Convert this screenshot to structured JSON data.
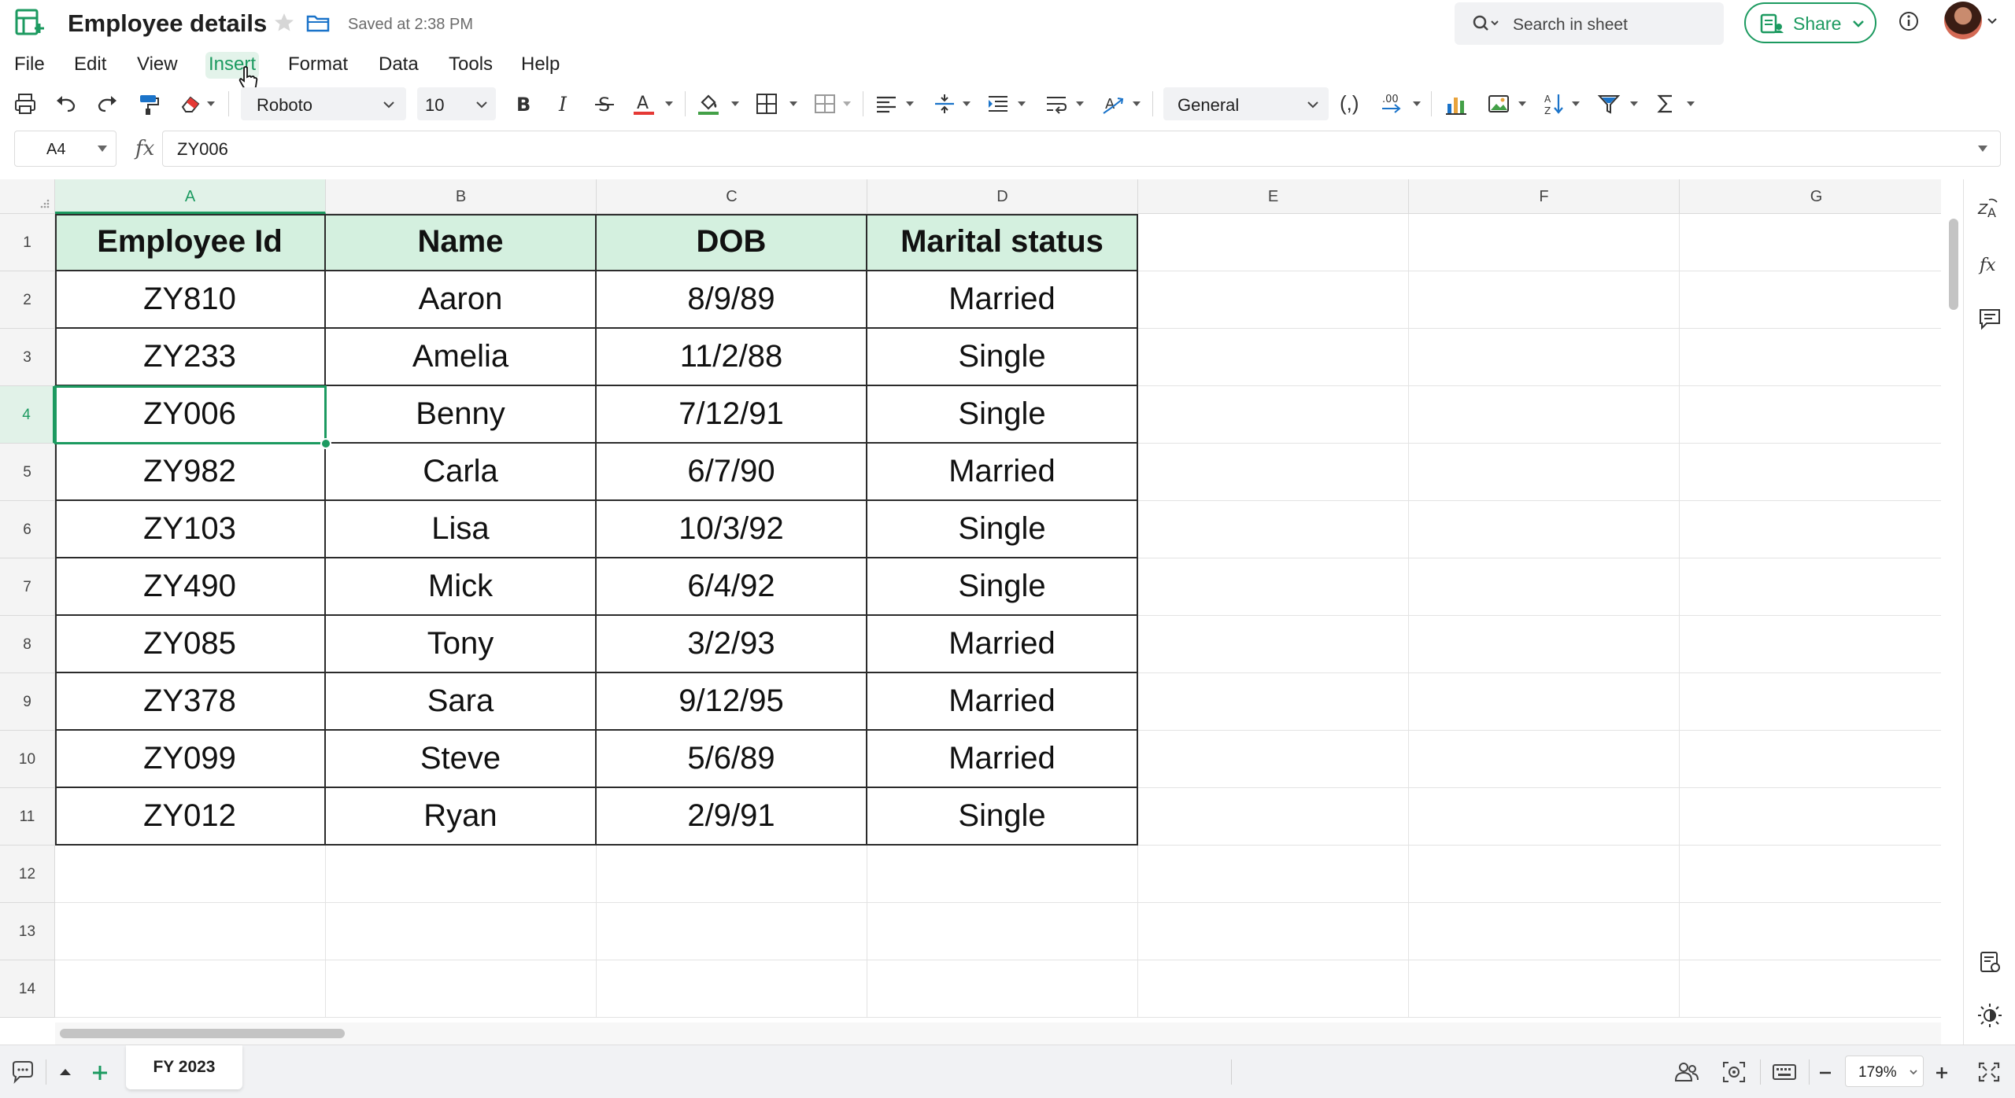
{
  "header": {
    "doc_title": "Employee details",
    "saved_status": "Saved at 2:38 PM",
    "search_placeholder": "Search in sheet",
    "share_label": "Share"
  },
  "menu": [
    "File",
    "Edit",
    "View",
    "Insert",
    "Format",
    "Data",
    "Tools",
    "Help"
  ],
  "menu_active": "Insert",
  "toolbar": {
    "font_family": "Roboto",
    "font_size": "10",
    "number_format": "General",
    "comma_style": "(,)",
    "decimal_label": ".00",
    "text_color": "#e53935",
    "fill_color": "#43a047"
  },
  "formula_bar": {
    "cell_ref": "A4",
    "fx": "fx",
    "value": "ZY006"
  },
  "grid": {
    "columns": [
      "A",
      "B",
      "C",
      "D",
      "E",
      "F",
      "G"
    ],
    "rows": [
      "1",
      "2",
      "3",
      "4",
      "5",
      "6",
      "7",
      "8",
      "9",
      "10",
      "11",
      "12",
      "13",
      "14"
    ],
    "selected_column": "A",
    "selected_row": "4",
    "table": {
      "headers": [
        "Employee Id",
        "Name",
        "DOB",
        "Marital status"
      ],
      "rows": [
        [
          "ZY810",
          "Aaron",
          "8/9/89",
          "Married"
        ],
        [
          "ZY233",
          "Amelia",
          "11/2/88",
          "Single"
        ],
        [
          "ZY006",
          "Benny",
          "7/12/91",
          "Single"
        ],
        [
          "ZY982",
          "Carla",
          "6/7/90",
          "Married"
        ],
        [
          "ZY103",
          "Lisa",
          "10/3/92",
          "Single"
        ],
        [
          "ZY490",
          "Mick",
          "6/4/92",
          "Single"
        ],
        [
          "ZY085",
          "Tony",
          "3/2/93",
          "Married"
        ],
        [
          "ZY378",
          "Sara",
          "9/12/95",
          "Married"
        ],
        [
          "ZY099",
          "Steve",
          "5/6/89",
          "Married"
        ],
        [
          "ZY012",
          "Ryan",
          "2/9/91",
          "Single"
        ]
      ],
      "header_fill": "#d4f0df"
    }
  },
  "footer": {
    "sheet_tab": "FY 2023",
    "zoom": "179%"
  },
  "colors": {
    "accent": "#1c9a60"
  }
}
